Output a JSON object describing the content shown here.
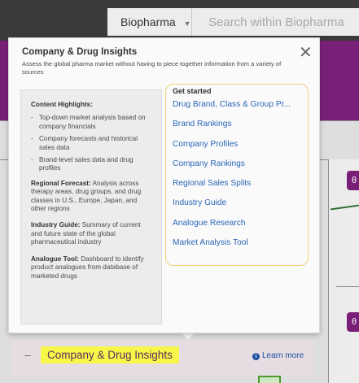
{
  "topbar": {
    "scope_label": "Biopharma",
    "search_placeholder": "Search within Biopharma"
  },
  "side_badges": [
    "θ",
    "θ"
  ],
  "popup": {
    "title": "Company & Drug Insights",
    "subtitle": "Assess the global pharma market without having to piece together information from a variety of sources",
    "close_label": "✕",
    "highlights": {
      "heading": "Content Highlights:",
      "items": [
        "Top-down market analysis based on company financials",
        "Company forecasts and historical sales data",
        "Brand-level sales data and drug profiles"
      ],
      "paragraphs": [
        {
          "label": "Regional Forecast:",
          "text": " Analysis across therapy areas, drug groups, and drug classes in U.S., Europe, Japan, and other regions"
        },
        {
          "label": "Industry Guide:",
          "text": " Summary of current and future state of the global pharmaceutical industry"
        },
        {
          "label": "Analogue Tool:",
          "text": " Dashboard to identify product analogues from database of marketed drugs"
        }
      ]
    },
    "get_started": {
      "heading": "Get started",
      "links": [
        "Drug Brand, Class & Group Pr...",
        "Brand Rankings",
        "Company Profiles",
        "Company Rankings",
        "Regional Sales Splits",
        "Industry Guide",
        "Analogue Research",
        "Market Analysis Tool"
      ]
    }
  },
  "insight_bar": {
    "dash": "–",
    "label": "Company & Drug Insights",
    "learn_more": "Learn more"
  },
  "colors": {
    "accent_purple": "#7a1f78",
    "link_blue": "#2a66b8",
    "highlight_yellow": "#f7f74a",
    "outline_yellow": "#f1cf73"
  }
}
